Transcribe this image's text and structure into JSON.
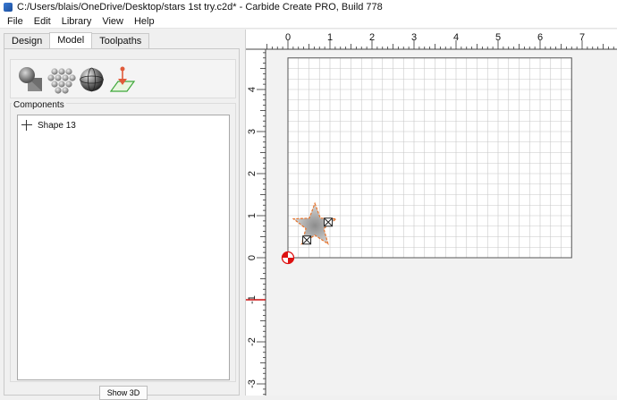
{
  "window": {
    "title": "C:/Users/blais/OneDrive/Desktop/stars 1st try.c2d* - Carbide Create PRO, Build 778"
  },
  "menu": [
    "File",
    "Edit",
    "Library",
    "View",
    "Help"
  ],
  "tabs": [
    {
      "label": "Design",
      "active": false
    },
    {
      "label": "Model",
      "active": true
    },
    {
      "label": "Toolpaths",
      "active": false
    }
  ],
  "model_tools": [
    {
      "icon": "add-shape-icon"
    },
    {
      "icon": "texture-pattern-icon"
    },
    {
      "icon": "sphere-icon"
    },
    {
      "icon": "import-model-icon"
    }
  ],
  "components": {
    "label": "Components",
    "items": [
      {
        "label": "Shape 13",
        "icon": "plus-icon"
      }
    ]
  },
  "buttons": {
    "show_3d": "Show 3D"
  },
  "rulers": {
    "top": [
      "0",
      "1",
      "2",
      "3",
      "4",
      "5",
      "6",
      "7"
    ],
    "left": [
      "4",
      "3",
      "2",
      "1",
      "0",
      "-1",
      "-2",
      "-3"
    ]
  },
  "stock": {
    "width": 6.75,
    "height": 4.75
  },
  "colors": {
    "grid": "#c8c8c8",
    "stock_border": "#555555",
    "star_outline": "#e8742c",
    "origin": "#dd1111",
    "axis_marker": "#cc1111"
  }
}
